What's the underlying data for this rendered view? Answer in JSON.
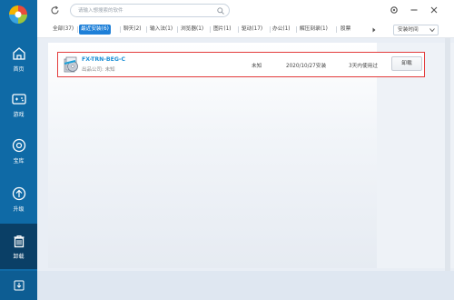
{
  "sidebar": {
    "items": [
      {
        "label": "首页",
        "icon": "home-icon"
      },
      {
        "label": "游戏",
        "icon": "gamepad-icon"
      },
      {
        "label": "宝库",
        "icon": "treasure-icon"
      },
      {
        "label": "升级",
        "icon": "upgrade-icon"
      },
      {
        "label": "卸载",
        "icon": "trash-icon"
      }
    ],
    "active": "卸载"
  },
  "search": {
    "placeholder": "请输入想搜索的软件"
  },
  "tabs": [
    {
      "label": "全部(37)"
    },
    {
      "label": "最近安装(6)"
    },
    {
      "label": "聊天(2)"
    },
    {
      "label": "输入法(1)"
    },
    {
      "label": "浏览器(1)"
    },
    {
      "label": "图片(1)"
    },
    {
      "label": "驱动(17)"
    },
    {
      "label": "办公(1)"
    },
    {
      "label": "解压刻录(1)"
    },
    {
      "label": "股票"
    }
  ],
  "active_tab": "最近安装(6)",
  "sort": {
    "label": "安装时间"
  },
  "list": [
    {
      "name": "FX-TRN-BEG-C",
      "publisher": "出品公司: 未知",
      "size": "未知",
      "install_date": "2020/10/27安装",
      "usage": "3天内使用过",
      "action": "卸载"
    }
  ],
  "colors": {
    "sidebar": "#0f6aa6",
    "sidebar_active": "#0a3f66",
    "accent": "#1d7fd8",
    "highlight": "#e33c3c",
    "app_name": "#1a8fd6"
  }
}
